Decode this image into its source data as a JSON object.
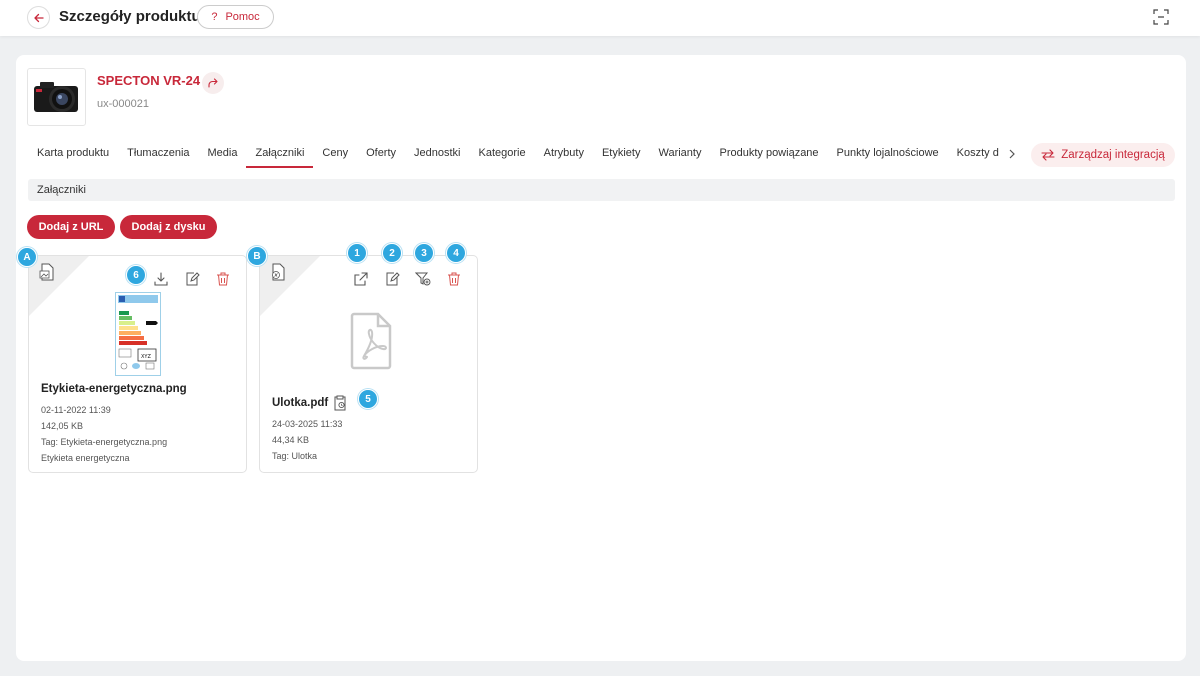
{
  "header": {
    "title": "Szczegóły produktu",
    "help_label": "Pomoc"
  },
  "product": {
    "name": "SPECTON VR-24",
    "code": "ux-000021"
  },
  "tabs": [
    {
      "label": "Karta produktu",
      "active": false
    },
    {
      "label": "Tłumaczenia",
      "active": false
    },
    {
      "label": "Media",
      "active": false
    },
    {
      "label": "Załączniki",
      "active": true
    },
    {
      "label": "Ceny",
      "active": false
    },
    {
      "label": "Oferty",
      "active": false
    },
    {
      "label": "Jednostki",
      "active": false
    },
    {
      "label": "Kategorie",
      "active": false
    },
    {
      "label": "Atrybuty",
      "active": false
    },
    {
      "label": "Etykiety",
      "active": false
    },
    {
      "label": "Warianty",
      "active": false
    },
    {
      "label": "Produkty powiązane",
      "active": false
    },
    {
      "label": "Punkty lojalnościowe",
      "active": false
    },
    {
      "label": "Koszty d",
      "active": false
    }
  ],
  "integrate_label": "Zarządzaj integracją",
  "section_title": "Załączniki",
  "buttons": {
    "add_url": "Dodaj z URL",
    "add_disk": "Dodaj z dysku"
  },
  "attachments": [
    {
      "name": "Etykieta-energetyczna.png",
      "date": "02-11-2022 11:39",
      "size": "142,05 KB",
      "tag": "Tag: Etykieta-energetyczna.png",
      "description": "Etykieta energetyczna",
      "label_text": "XYZ"
    },
    {
      "name": "Ulotka.pdf",
      "date": "24-03-2025 11:33",
      "size": "44,34 KB",
      "tag": "Tag: Ulotka"
    }
  ],
  "badges": {
    "a": "A",
    "b": "B",
    "n1": "1",
    "n2": "2",
    "n3": "3",
    "n4": "4",
    "n5": "5",
    "n6": "6"
  },
  "colors": {
    "accent": "#c8283a",
    "badge": "#2ea7df",
    "background": "#eef0f2"
  }
}
